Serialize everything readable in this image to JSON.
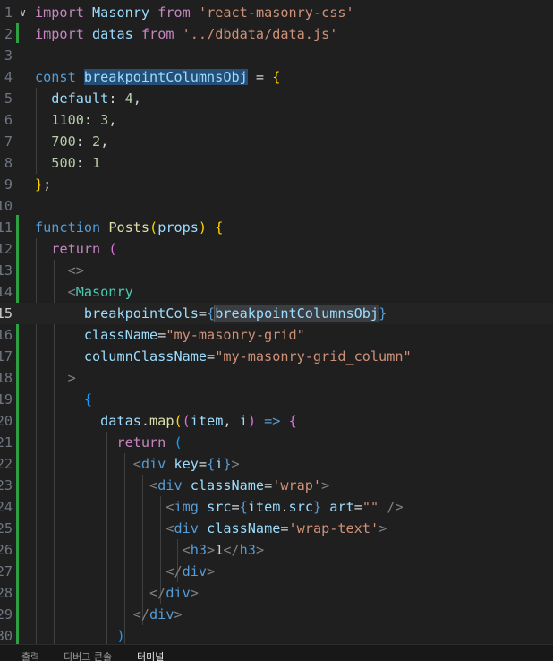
{
  "editor": {
    "active_line": 15,
    "lines": [
      {
        "n": "1",
        "fold": "∨",
        "parts": [
          [
            "kw",
            "import"
          ],
          [
            "pl",
            " "
          ],
          [
            "va",
            "Masonry"
          ],
          [
            "pl",
            " "
          ],
          [
            "kw",
            "from"
          ],
          [
            "pl",
            " "
          ],
          [
            "st",
            "'react-masonry-css'"
          ]
        ]
      },
      {
        "n": "2",
        "parts": [
          [
            "kw",
            "import"
          ],
          [
            "pl",
            " "
          ],
          [
            "va",
            "datas"
          ],
          [
            "pl",
            " "
          ],
          [
            "kw",
            "from"
          ],
          [
            "pl",
            " "
          ],
          [
            "st",
            "'../dbdata/data.js'"
          ]
        ]
      },
      {
        "n": "3",
        "parts": []
      },
      {
        "n": "4",
        "parts": [
          [
            "sk",
            "const"
          ],
          [
            "pl",
            " "
          ],
          [
            "va hl",
            "breakpointColumnsObj"
          ],
          [
            "pl",
            " = "
          ],
          [
            "b1",
            "{"
          ]
        ]
      },
      {
        "n": "5",
        "parts": [
          [
            "pl",
            "  "
          ],
          [
            "va",
            "default"
          ],
          [
            "pl",
            ": "
          ],
          [
            "nu",
            "4"
          ],
          [
            "pl",
            ","
          ]
        ]
      },
      {
        "n": "6",
        "parts": [
          [
            "pl",
            "  "
          ],
          [
            "nu",
            "1100"
          ],
          [
            "pl",
            ": "
          ],
          [
            "nu",
            "3"
          ],
          [
            "pl",
            ","
          ]
        ]
      },
      {
        "n": "7",
        "parts": [
          [
            "pl",
            "  "
          ],
          [
            "nu",
            "700"
          ],
          [
            "pl",
            ": "
          ],
          [
            "nu",
            "2"
          ],
          [
            "pl",
            ","
          ]
        ]
      },
      {
        "n": "8",
        "parts": [
          [
            "pl",
            "  "
          ],
          [
            "nu",
            "500"
          ],
          [
            "pl",
            ": "
          ],
          [
            "nu",
            "1"
          ]
        ]
      },
      {
        "n": "9",
        "parts": [
          [
            "b1",
            "}"
          ],
          [
            "pl",
            ";"
          ]
        ]
      },
      {
        "n": "10",
        "parts": []
      },
      {
        "n": "11",
        "parts": [
          [
            "sk",
            "function"
          ],
          [
            "pl",
            " "
          ],
          [
            "fn",
            "Posts"
          ],
          [
            "b1",
            "("
          ],
          [
            "va",
            "props"
          ],
          [
            "b1",
            ")"
          ],
          [
            "pl",
            " "
          ],
          [
            "b1",
            "{"
          ]
        ]
      },
      {
        "n": "12",
        "parts": [
          [
            "pl",
            "  "
          ],
          [
            "kw",
            "return"
          ],
          [
            "pl",
            " "
          ],
          [
            "b2",
            "("
          ]
        ]
      },
      {
        "n": "13",
        "parts": [
          [
            "pl",
            "    "
          ],
          [
            "tb",
            "<>"
          ]
        ]
      },
      {
        "n": "14",
        "parts": [
          [
            "pl",
            "    "
          ],
          [
            "tb",
            "<"
          ],
          [
            "tg",
            "Masonry"
          ]
        ]
      },
      {
        "n": "15",
        "parts": [
          [
            "pl",
            "      "
          ],
          [
            "va",
            "breakpointCols"
          ],
          [
            "pl",
            "="
          ],
          [
            "sk",
            "{"
          ],
          [
            "va hl2",
            "breakpointColumnsObj"
          ],
          [
            "sk",
            "}"
          ]
        ]
      },
      {
        "n": "16",
        "parts": [
          [
            "pl",
            "      "
          ],
          [
            "va",
            "className"
          ],
          [
            "pl",
            "="
          ],
          [
            "st",
            "\"my-masonry-grid\""
          ]
        ]
      },
      {
        "n": "17",
        "parts": [
          [
            "pl",
            "      "
          ],
          [
            "va",
            "columnClassName"
          ],
          [
            "pl",
            "="
          ],
          [
            "st",
            "\"my-masonry-grid_column\""
          ]
        ]
      },
      {
        "n": "18",
        "parts": [
          [
            "pl",
            "    "
          ],
          [
            "tb",
            ">"
          ]
        ]
      },
      {
        "n": "19",
        "parts": [
          [
            "pl",
            "      "
          ],
          [
            "b3",
            "{"
          ]
        ]
      },
      {
        "n": "20",
        "parts": [
          [
            "pl",
            "        "
          ],
          [
            "va",
            "datas"
          ],
          [
            "pl",
            "."
          ],
          [
            "fn",
            "map"
          ],
          [
            "b1",
            "("
          ],
          [
            "b2",
            "("
          ],
          [
            "va",
            "item"
          ],
          [
            "pl",
            ", "
          ],
          [
            "va",
            "i"
          ],
          [
            "b2",
            ")"
          ],
          [
            "pl",
            " "
          ],
          [
            "sk",
            "=>"
          ],
          [
            "pl",
            " "
          ],
          [
            "b2",
            "{"
          ]
        ]
      },
      {
        "n": "21",
        "parts": [
          [
            "pl",
            "          "
          ],
          [
            "kw",
            "return"
          ],
          [
            "pl",
            " "
          ],
          [
            "b3",
            "("
          ]
        ]
      },
      {
        "n": "22",
        "parts": [
          [
            "pl",
            "            "
          ],
          [
            "tb",
            "<"
          ],
          [
            "sk",
            "div"
          ],
          [
            "pl",
            " "
          ],
          [
            "va",
            "key"
          ],
          [
            "pl",
            "="
          ],
          [
            "sk",
            "{"
          ],
          [
            "va",
            "i"
          ],
          [
            "sk",
            "}"
          ],
          [
            "tb",
            ">"
          ]
        ]
      },
      {
        "n": "23",
        "parts": [
          [
            "pl",
            "              "
          ],
          [
            "tb",
            "<"
          ],
          [
            "sk",
            "div"
          ],
          [
            "pl",
            " "
          ],
          [
            "va",
            "className"
          ],
          [
            "pl",
            "="
          ],
          [
            "st",
            "'wrap'"
          ],
          [
            "tb",
            ">"
          ]
        ]
      },
      {
        "n": "24",
        "parts": [
          [
            "pl",
            "                "
          ],
          [
            "tb",
            "<"
          ],
          [
            "sk",
            "img"
          ],
          [
            "pl",
            " "
          ],
          [
            "va",
            "src"
          ],
          [
            "pl",
            "="
          ],
          [
            "sk",
            "{"
          ],
          [
            "va",
            "item"
          ],
          [
            "pl",
            "."
          ],
          [
            "va",
            "src"
          ],
          [
            "sk",
            "}"
          ],
          [
            "pl",
            " "
          ],
          [
            "va",
            "art"
          ],
          [
            "pl",
            "="
          ],
          [
            "st",
            "\"\""
          ],
          [
            "pl",
            " "
          ],
          [
            "tb",
            "/>"
          ]
        ]
      },
      {
        "n": "25",
        "parts": [
          [
            "pl",
            "                "
          ],
          [
            "tb",
            "<"
          ],
          [
            "sk",
            "div"
          ],
          [
            "pl",
            " "
          ],
          [
            "va",
            "className"
          ],
          [
            "pl",
            "="
          ],
          [
            "st",
            "'wrap-text'"
          ],
          [
            "tb",
            ">"
          ]
        ]
      },
      {
        "n": "26",
        "parts": [
          [
            "pl",
            "                  "
          ],
          [
            "tb",
            "<"
          ],
          [
            "sk",
            "h3"
          ],
          [
            "tb",
            ">"
          ],
          [
            "pl",
            "1"
          ],
          [
            "tb",
            "</"
          ],
          [
            "sk",
            "h3"
          ],
          [
            "tb",
            ">"
          ]
        ]
      },
      {
        "n": "27",
        "parts": [
          [
            "pl",
            "                "
          ],
          [
            "tb",
            "</"
          ],
          [
            "sk",
            "div"
          ],
          [
            "tb",
            ">"
          ]
        ]
      },
      {
        "n": "28",
        "parts": [
          [
            "pl",
            "              "
          ],
          [
            "tb",
            "</"
          ],
          [
            "sk",
            "div"
          ],
          [
            "tb",
            ">"
          ]
        ]
      },
      {
        "n": "29",
        "parts": [
          [
            "pl",
            "            "
          ],
          [
            "tb",
            "</"
          ],
          [
            "sk",
            "div"
          ],
          [
            "tb",
            ">"
          ]
        ]
      },
      {
        "n": "30",
        "parts": [
          [
            "pl",
            "          "
          ],
          [
            "b3",
            ")"
          ]
        ]
      }
    ]
  },
  "panel": {
    "tabs": [
      {
        "label": "출력",
        "active": false
      },
      {
        "label": "디버그 콘솔",
        "active": false
      },
      {
        "label": "터미널",
        "active": true
      }
    ]
  }
}
